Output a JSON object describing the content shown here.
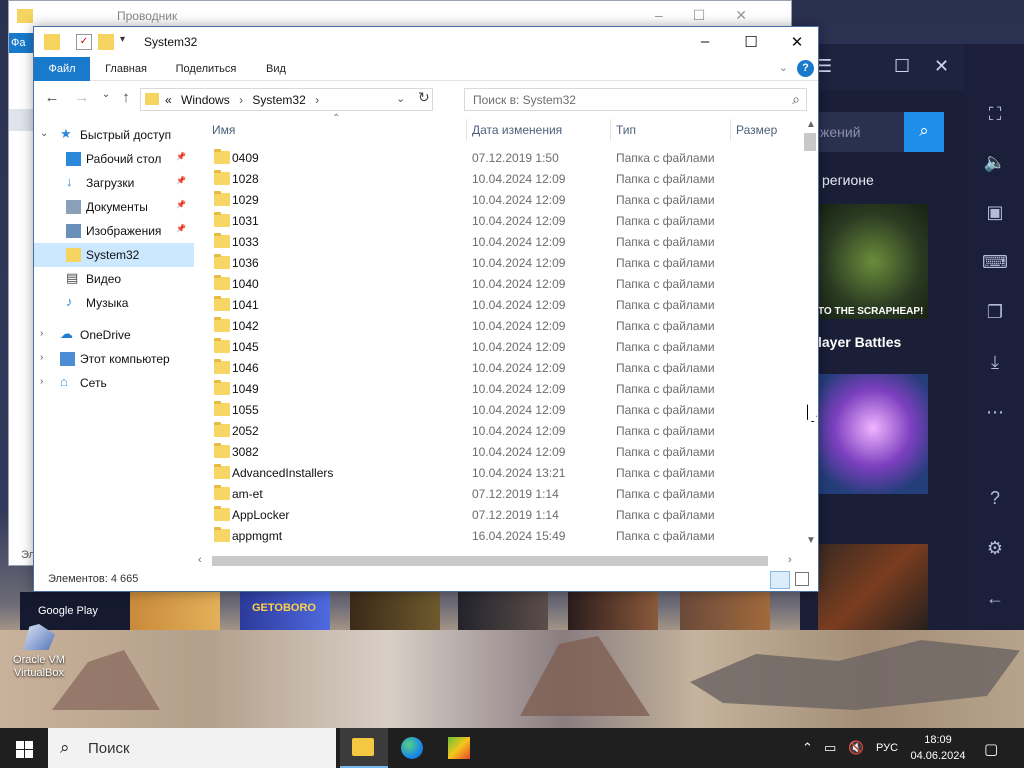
{
  "desktop": {
    "icon_label": "Oracle VM VirtualBox"
  },
  "bg_window": {
    "title": "Проводник",
    "ribbon_tab": "Фа",
    "status_stub": "Эл"
  },
  "emulator": {
    "search_placeholder": "жений",
    "region_text": "регионе",
    "tile1_caption": "TO THE SCRAPHEAP!",
    "tile_heading": "layer Battles",
    "google_play": "Google Play",
    "strip_game_label": "GETOBORO"
  },
  "window": {
    "title": "System32",
    "ribbon_tabs": [
      "Файл",
      "Главная",
      "Поделиться",
      "Вид"
    ],
    "address": {
      "prefix": "«",
      "crumbs": [
        "Windows",
        "System32"
      ]
    },
    "search_placeholder": "Поиск в: System32",
    "nav_pane": [
      {
        "label": "Быстрый доступ",
        "icon": "star-icon",
        "pinned": false,
        "level": 0,
        "expand": "open"
      },
      {
        "label": "Рабочий стол",
        "icon": "desktop-icon",
        "pinned": true,
        "level": 1
      },
      {
        "label": "Загрузки",
        "icon": "download-icon",
        "pinned": true,
        "level": 1
      },
      {
        "label": "Документы",
        "icon": "documents-icon",
        "pinned": true,
        "level": 1
      },
      {
        "label": "Изображения",
        "icon": "pictures-icon",
        "pinned": true,
        "level": 1
      },
      {
        "label": "System32",
        "icon": "folder-icon",
        "pinned": false,
        "level": 1,
        "selected": true
      },
      {
        "label": "Видео",
        "icon": "video-icon",
        "pinned": false,
        "level": 1
      },
      {
        "label": "Музыка",
        "icon": "music-icon",
        "pinned": false,
        "level": 1
      },
      {
        "label": "OneDrive",
        "icon": "cloud-icon",
        "pinned": false,
        "level": 0,
        "expand": "closed"
      },
      {
        "label": "Этот компьютер",
        "icon": "computer-icon",
        "pinned": false,
        "level": 0,
        "expand": "closed"
      },
      {
        "label": "Сеть",
        "icon": "network-icon",
        "pinned": false,
        "level": 0,
        "expand": "closed"
      }
    ],
    "columns": [
      "Имя",
      "Дата изменения",
      "Тип",
      "Размер"
    ],
    "files": [
      {
        "name": "0409",
        "date": "07.12.2019 1:50",
        "type": "Папка с файлами"
      },
      {
        "name": "1028",
        "date": "10.04.2024 12:09",
        "type": "Папка с файлами"
      },
      {
        "name": "1029",
        "date": "10.04.2024 12:09",
        "type": "Папка с файлами"
      },
      {
        "name": "1031",
        "date": "10.04.2024 12:09",
        "type": "Папка с файлами"
      },
      {
        "name": "1033",
        "date": "10.04.2024 12:09",
        "type": "Папка с файлами"
      },
      {
        "name": "1036",
        "date": "10.04.2024 12:09",
        "type": "Папка с файлами"
      },
      {
        "name": "1040",
        "date": "10.04.2024 12:09",
        "type": "Папка с файлами"
      },
      {
        "name": "1041",
        "date": "10.04.2024 12:09",
        "type": "Папка с файлами"
      },
      {
        "name": "1042",
        "date": "10.04.2024 12:09",
        "type": "Папка с файлами"
      },
      {
        "name": "1045",
        "date": "10.04.2024 12:09",
        "type": "Папка с файлами"
      },
      {
        "name": "1046",
        "date": "10.04.2024 12:09",
        "type": "Папка с файлами"
      },
      {
        "name": "1049",
        "date": "10.04.2024 12:09",
        "type": "Папка с файлами"
      },
      {
        "name": "1055",
        "date": "10.04.2024 12:09",
        "type": "Папка с файлами"
      },
      {
        "name": "2052",
        "date": "10.04.2024 12:09",
        "type": "Папка с файлами"
      },
      {
        "name": "3082",
        "date": "10.04.2024 12:09",
        "type": "Папка с файлами"
      },
      {
        "name": "AdvancedInstallers",
        "date": "10.04.2024 13:21",
        "type": "Папка с файлами"
      },
      {
        "name": "am-et",
        "date": "07.12.2019 1:14",
        "type": "Папка с файлами"
      },
      {
        "name": "AppLocker",
        "date": "07.12.2019 1:14",
        "type": "Папка с файлами"
      },
      {
        "name": "appmgmt",
        "date": "16.04.2024 15:49",
        "type": "Папка с файлами"
      }
    ],
    "status": "Элементов: 4 665"
  },
  "taskbar": {
    "search_label": "Поиск",
    "language": "РУС",
    "time": "18:09",
    "date": "04.06.2024"
  },
  "colors": {
    "accent": "#1979ca",
    "selection": "#cce8ff",
    "folder": "#f8d666",
    "taskbar": "#1f1f1f",
    "emulator_bg": "#1a1e37"
  }
}
